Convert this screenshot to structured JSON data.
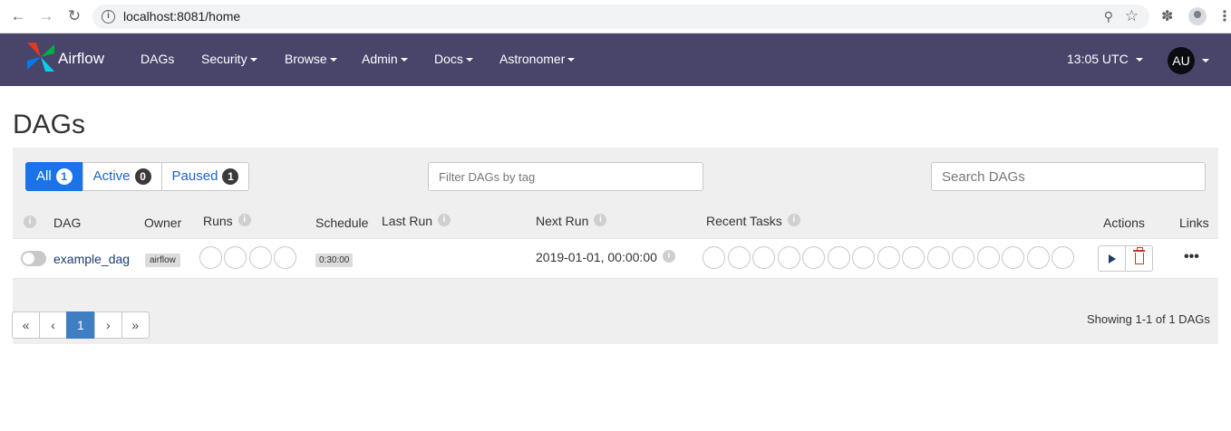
{
  "browser": {
    "url": "localhost:8081/home",
    "back_icon": "arrow-left-icon",
    "forward_icon": "arrow-right-icon",
    "reload_icon": "reload-icon"
  },
  "navbar": {
    "brand": "Airflow",
    "items": [
      "DAGs",
      "Security",
      "Browse",
      "Admin",
      "Docs",
      "Astronomer"
    ],
    "time": "13:05 UTC",
    "user_initials": "AU",
    "colors": {
      "background": "#48446a"
    }
  },
  "page": {
    "title": "DAGs",
    "tabs": [
      {
        "label": "All",
        "count": "1"
      },
      {
        "label": "Active",
        "count": "0"
      },
      {
        "label": "Paused",
        "count": "1"
      }
    ],
    "tag_filter_placeholder": "Filter DAGs by tag",
    "search_placeholder": "Search DAGs"
  },
  "table": {
    "headers": {
      "dag": "DAG",
      "owner": "Owner",
      "runs": "Runs",
      "schedule": "Schedule",
      "last_run": "Last Run",
      "next_run": "Next Run",
      "recent_tasks": "Recent Tasks",
      "actions": "Actions",
      "links": "Links"
    },
    "rows": [
      {
        "dag_id": "example_dag",
        "owner": "airflow",
        "schedule": "0:30:00",
        "last_run": "",
        "next_run": "2019-01-01, 00:00:00",
        "paused": true
      }
    ],
    "links_label": "•••"
  },
  "pagination": {
    "first": "«",
    "prev": "‹",
    "current": "1",
    "next": "›",
    "last": "»",
    "summary": "Showing 1-1 of 1 DAGs"
  }
}
